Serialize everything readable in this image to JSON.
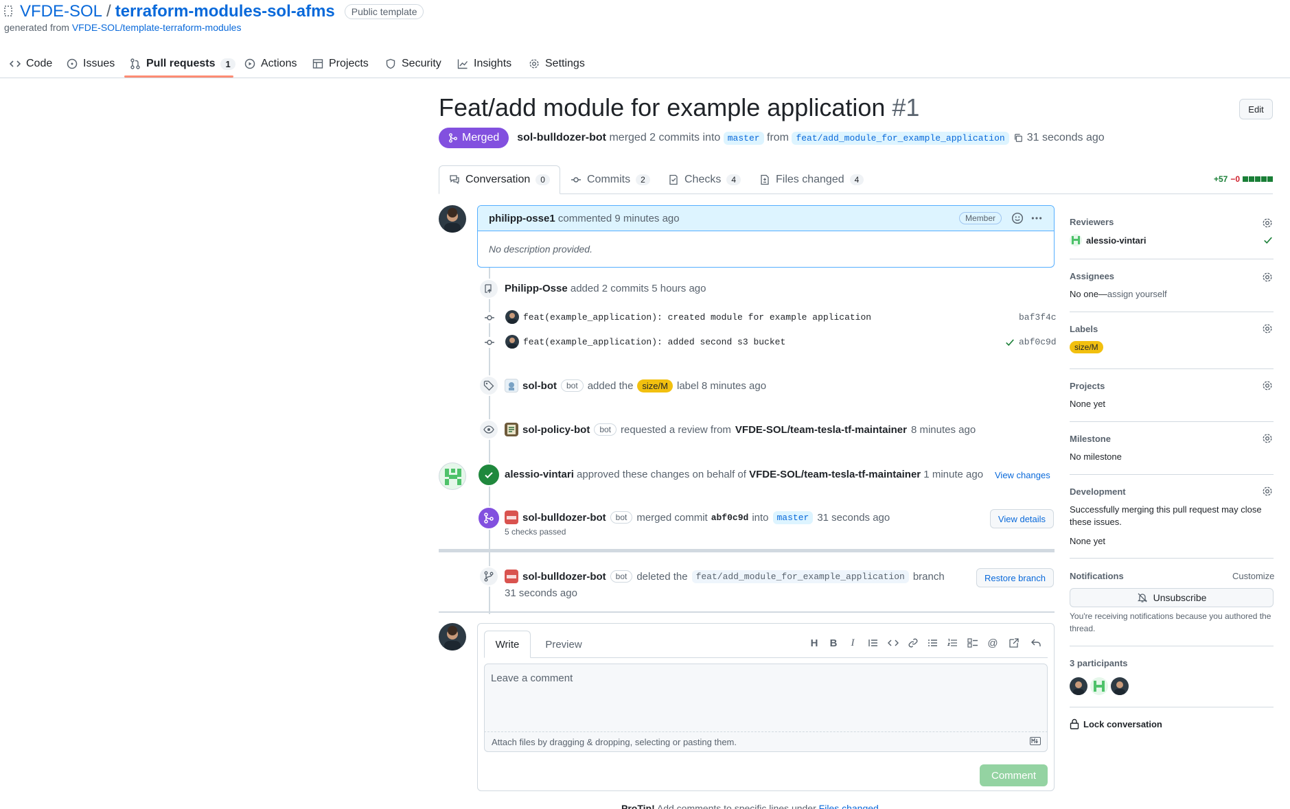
{
  "repo": {
    "owner": "VFDE-SOL",
    "slash": "/",
    "name": "terraform-modules-sol-afms",
    "badge": "Public template",
    "generated_prefix": "generated from ",
    "generated_link": "VFDE-SOL/template-terraform-modules"
  },
  "nav": {
    "code": "Code",
    "issues": "Issues",
    "pulls": "Pull requests",
    "pulls_count": "1",
    "actions": "Actions",
    "projects": "Projects",
    "security": "Security",
    "insights": "Insights",
    "settings": "Settings"
  },
  "pr": {
    "title": "Feat/add module for example application",
    "number": "#1",
    "edit": "Edit",
    "state": "Merged",
    "author": "sol-bulldozer-bot",
    "merged_text": " merged 2 commits into ",
    "base": "master",
    "from": " from ",
    "head": "feat/add_module_for_example_application",
    "time": "31 seconds ago"
  },
  "prtabs": {
    "conversation": "Conversation",
    "conversation_count": "0",
    "commits": "Commits",
    "commits_count": "2",
    "checks": "Checks",
    "checks_count": "4",
    "files": "Files changed",
    "files_count": "4",
    "additions": "+57",
    "deletions": "−0"
  },
  "timeline": {
    "comment": {
      "author": "philipp-osse1",
      "action": " commented 9 minutes ago",
      "role": "Member",
      "body": "No description provided."
    },
    "commits_event": {
      "actor": "Philipp-Osse",
      "text": " added 2 commits 5 hours ago"
    },
    "commits": [
      {
        "message": "feat(example_application): created module for example application",
        "sha": "baf3f4c"
      },
      {
        "message": "feat(example_application): added second s3 bucket",
        "sha": "abf0c9d"
      }
    ],
    "label_event": {
      "actor": "sol-bot",
      "bot": "bot",
      "text1": "added the",
      "label": "size/M",
      "text2": "label 8 minutes ago"
    },
    "review_req": {
      "actor": "sol-policy-bot",
      "bot": "bot",
      "text1": "requested a review from",
      "team": "VFDE-SOL/team-tesla-tf-maintainer",
      "text2": "8 minutes ago"
    },
    "approve": {
      "actor": "alessio-vintari",
      "text1": " approved these changes on behalf of ",
      "team": "VFDE-SOL/team-tesla-tf-maintainer",
      "text2": " 1 minute ago",
      "button": "View changes"
    },
    "merge": {
      "actor": "sol-bulldozer-bot",
      "bot": "bot",
      "text1": "merged commit",
      "sha": "abf0c9d",
      "text2": "into",
      "base": "master",
      "text3": "31 seconds ago",
      "checks": "5 checks passed",
      "button": "View details"
    },
    "delete": {
      "actor": "sol-bulldozer-bot",
      "bot": "bot",
      "text1": "deleted the",
      "branch": "feat/add_module_for_example_application",
      "text2": "branch",
      "time": "31 seconds ago",
      "button": "Restore branch"
    }
  },
  "composer": {
    "write": "Write",
    "preview": "Preview",
    "placeholder": "Leave a comment",
    "attach": "Attach files by dragging & dropping, selecting or pasting them.",
    "submit": "Comment",
    "protip_label": "ProTip!",
    "protip_text": " Add comments to specific lines under ",
    "protip_link": "Files changed."
  },
  "sidebar": {
    "reviewers_title": "Reviewers",
    "reviewer": "alessio-vintari",
    "assignees_title": "Assignees",
    "assignees_none": "No one—",
    "assign_yourself": "assign yourself",
    "labels_title": "Labels",
    "label": "size/M",
    "projects_title": "Projects",
    "projects_val": "None yet",
    "milestone_title": "Milestone",
    "milestone_val": "No milestone",
    "development_title": "Development",
    "development_text": "Successfully merging this pull request may close these issues.",
    "development_val": "None yet",
    "notifications_title": "Notifications",
    "customize": "Customize",
    "unsubscribe": "Unsubscribe",
    "notif_reason": "You're receiving notifications because you authored the thread.",
    "participants_title": "3 participants",
    "lock": "Lock conversation"
  },
  "colors": {
    "accent": "#0969da",
    "merged": "#8250df",
    "success": "#1a7f37",
    "label": "#f2c00f",
    "tab_underline": "#fd8c73"
  }
}
